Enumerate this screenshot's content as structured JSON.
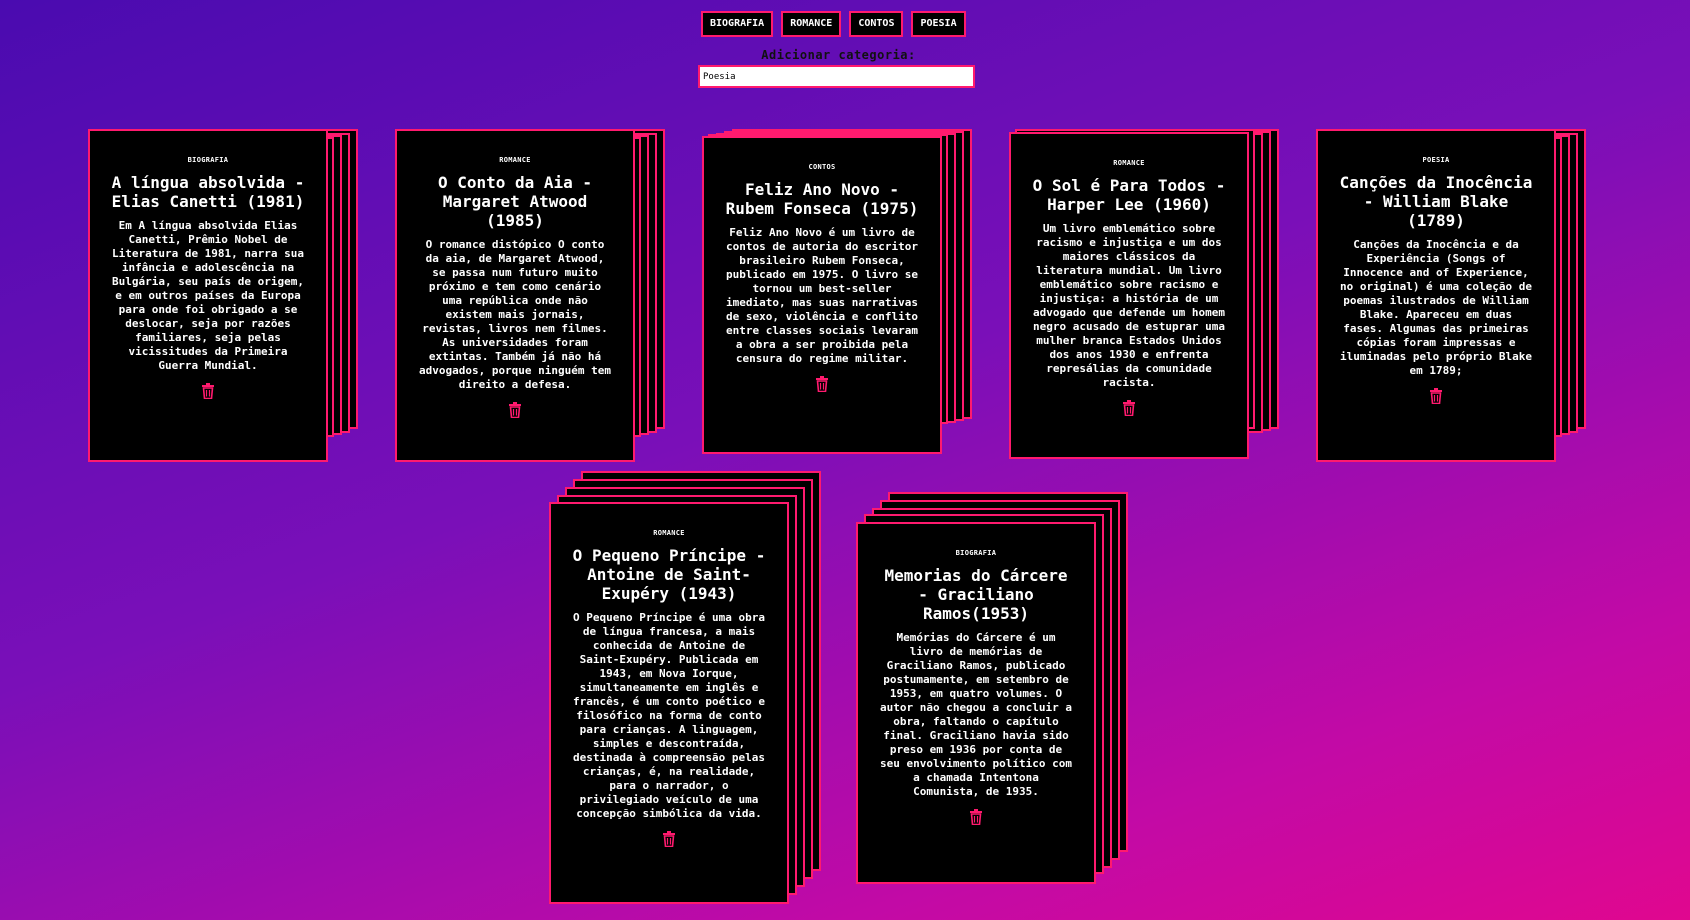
{
  "nav": {
    "categories": [
      "BIOGRAFIA",
      "ROMANCE",
      "CONTOS",
      "POESIA"
    ]
  },
  "add_category": {
    "label": "Adicionar categoria:",
    "value": "Poesia"
  },
  "colors": {
    "accent": "#ff1a6e",
    "card_bg": "#000000",
    "text": "#ffffff"
  },
  "cards": [
    {
      "category": "BIOGRAFIA",
      "title": "A língua absolvida - Elias Canetti (1981)",
      "description": "Em A língua absolvida Elias Canetti, Prêmio Nobel de Literatura de 1981, narra sua infância e adolescência na Bulgária, seu país de origem, e em outros países da Europa para onde foi obrigado a se deslocar, seja por razões familiares, seja pelas vicissitudes da Primeira Guerra Mundial.",
      "delete_icon": "trash-icon"
    },
    {
      "category": "ROMANCE",
      "title": "O Conto da Aia - Margaret Atwood (1985)",
      "description": "O romance distópico O conto da aia, de Margaret Atwood, se passa num futuro muito próximo e tem como cenário uma república onde não existem mais jornais, revistas, livros nem filmes. As universidades foram extintas. Também já não há advogados, porque ninguém tem direito a defesa.",
      "delete_icon": "trash-icon"
    },
    {
      "category": "CONTOS",
      "title": "Feliz Ano Novo - Rubem Fonseca (1975)",
      "description": "Feliz Ano Novo é um livro de contos de autoria do escritor brasileiro Rubem Fonseca, publicado em 1975. O livro se tornou um best-seller imediato, mas suas narrativas de sexo, violência e conflito entre classes sociais levaram a obra a ser proibida pela censura do regime militar.",
      "delete_icon": "trash-icon"
    },
    {
      "category": "ROMANCE",
      "title": "O Sol é Para Todos - Harper Lee (1960)",
      "description": "Um livro emblemático sobre racismo e injustiça e um dos maiores clássicos da literatura mundial. Um livro emblemático sobre racismo e injustiça: a história de um advogado que defende um homem negro acusado de estuprar uma mulher branca Estados Unidos dos anos 1930 e enfrenta represálias da comunidade racista.",
      "delete_icon": "trash-icon"
    },
    {
      "category": "POESIA",
      "title": "Canções da Inocência - William Blake (1789)",
      "description": "Canções da Inocência e da Experiência (Songs of Innocence and of Experience, no original) é uma coleção de poemas ilustrados de William Blake. Apareceu em duas fases. Algumas das primeiras cópias foram impressas e iluminadas pelo próprio Blake em 1789;",
      "delete_icon": "trash-icon"
    },
    {
      "category": "ROMANCE",
      "title": "O Pequeno Príncipe - Antoine de Saint-Exupéry (1943)",
      "description": "O Pequeno Príncipe é uma obra de língua francesa, a mais conhecida de Antoine de Saint-Exupéry. Publicada em 1943, em Nova Iorque, simultaneamente em inglês e francês, é um conto poético e filosófico na forma de conto para crianças. A linguagem, simples e descontraída, destinada à compreensão pelas crianças, é, na realidade, para o narrador, o privilegiado veículo de uma concepção simbólica da vida.",
      "delete_icon": "trash-icon"
    },
    {
      "category": "BIOGRAFIA",
      "title": "Memorias do Cárcere - Graciliano Ramos(1953)",
      "description": "Memórias do Cárcere é um livro de memórias de Graciliano Ramos, publicado postumamente, em setembro de 1953, em quatro volumes. O autor não chegou a concluir a obra, faltando o capítulo final. Graciliano havia sido preso em 1936 por conta de seu envolvimento político com a chamada Intentona Comunista, de 1935.",
      "delete_icon": "trash-icon"
    }
  ]
}
